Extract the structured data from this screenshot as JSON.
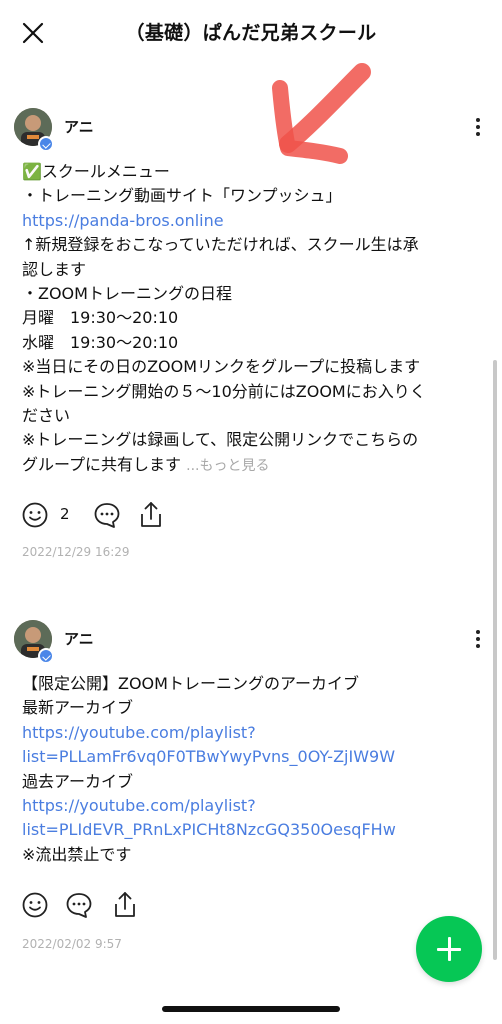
{
  "header": {
    "title": "（基礎）ぱんだ兄弟スクール",
    "close_icon": "close-icon"
  },
  "colors": {
    "link": "#4a7de0",
    "fab": "#06c755",
    "timestamp": "#b2b2b2",
    "arrow": "#f0524a"
  },
  "posts": [
    {
      "author": "アニ",
      "lines": [
        "✅スクールメニュー",
        "・トレーニング動画サイト「ワンプッシュ」",
        "https://panda-bros.online",
        "↑新規登録をおこなっていただければ、スクール生は承",
        "認します",
        "・ZOOMトレーニングの日程",
        "月曜　19:30～20:10",
        "水曜　19:30～20:10",
        "※当日にその日のZOOMリンクをグループに投稿します",
        "※トレーニング開始の５～10分前にはZOOMにお入りく",
        "ださい",
        "※トレーニングは録画して、限定公開リンクでこちらの",
        "グループに共有します"
      ],
      "more_label": "...もっと見る",
      "reaction_count": "2",
      "timestamp": "2022/12/29 16:29"
    },
    {
      "author": "アニ",
      "lines": [
        "【限定公開】ZOOMトレーニングのアーカイブ",
        "最新アーカイブ",
        "https://youtube.com/playlist?",
        "list=PLLamFr6vq0F0TBwYwyPvns_0OY-ZjIW9W",
        "過去アーカイブ",
        "https://youtube.com/playlist?",
        "list=PLIdEVR_PRnLxPICHt8NzcGQ350OesqFHw",
        "※流出禁止です"
      ],
      "timestamp": "2022/02/02 9:57"
    }
  ]
}
